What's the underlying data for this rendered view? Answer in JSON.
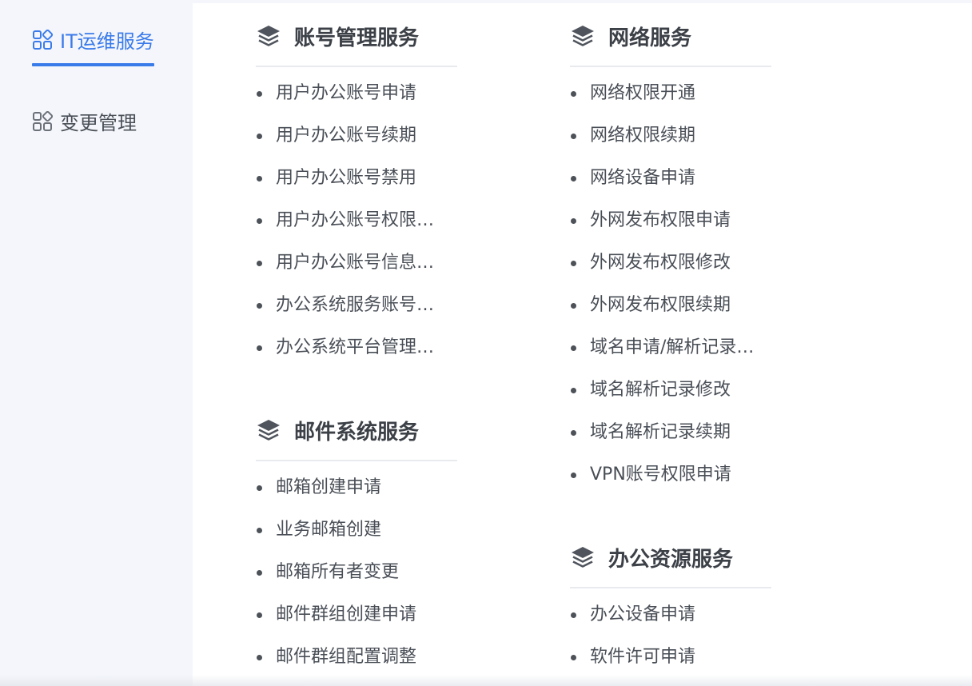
{
  "sidebar": {
    "items": [
      {
        "label": "IT运维服务",
        "icon": "apps-grid-icon",
        "active": true
      },
      {
        "label": "变更管理",
        "icon": "apps-grid-icon",
        "active": false
      }
    ]
  },
  "colors": {
    "accent": "#3a7bea",
    "text": "#4a4f57",
    "heading": "#3c4047"
  },
  "sections": {
    "account": {
      "title": "账号管理服务",
      "icon": "layers-icon",
      "items": [
        "用户办公账号申请",
        "用户办公账号续期",
        "用户办公账号禁用",
        "用户办公账号权限…",
        "用户办公账号信息…",
        "办公系统服务账号…",
        "办公系统平台管理…"
      ]
    },
    "mail": {
      "title": "邮件系统服务",
      "icon": "layers-icon",
      "items": [
        "邮箱创建申请",
        "业务邮箱创建",
        "邮箱所有者变更",
        "邮件群组创建申请",
        "邮件群组配置调整"
      ]
    },
    "network": {
      "title": "网络服务",
      "icon": "layers-icon",
      "items": [
        "网络权限开通",
        "网络权限续期",
        "网络设备申请",
        "外网发布权限申请",
        "外网发布权限修改",
        "外网发布权限续期",
        "域名申请/解析记录…",
        "域名解析记录修改",
        "域名解析记录续期",
        "VPN账号权限申请"
      ]
    },
    "office": {
      "title": "办公资源服务",
      "icon": "layers-icon",
      "items": [
        "办公设备申请",
        "软件许可申请"
      ]
    }
  }
}
